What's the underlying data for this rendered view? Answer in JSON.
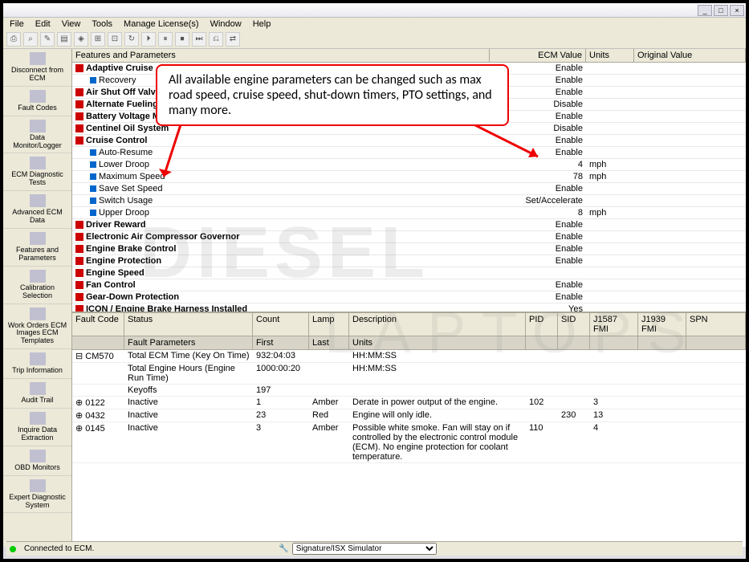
{
  "window": {
    "min": "_",
    "max": "□",
    "close": "×"
  },
  "menu": [
    "File",
    "Edit",
    "View",
    "Tools",
    "Manage License(s)",
    "Window",
    "Help"
  ],
  "sidebar": [
    {
      "label": "Disconnect from ECM"
    },
    {
      "label": "Fault Codes"
    },
    {
      "label": "Data Monitor/Logger"
    },
    {
      "label": "ECM Diagnostic Tests"
    },
    {
      "label": "Advanced ECM Data"
    },
    {
      "label": "Features and Parameters"
    },
    {
      "label": "Calibration Selection"
    },
    {
      "label": "Work Orders ECM Images ECM Templates"
    },
    {
      "label": "Trip Information"
    },
    {
      "label": "Audit Trail"
    },
    {
      "label": "Inquire Data Extraction"
    },
    {
      "label": "OBD Monitors"
    },
    {
      "label": "Expert Diagnostic System"
    }
  ],
  "params_header": {
    "c1": "Features and Parameters",
    "c2": "ECM Value",
    "c3": "Units",
    "c4": "Original Value"
  },
  "params": [
    {
      "name": "Adaptive Cruise",
      "val": "Enable",
      "unit": "",
      "bold": true,
      "sub": false
    },
    {
      "name": "Recovery",
      "val": "Enable",
      "unit": "",
      "bold": false,
      "sub": true
    },
    {
      "name": "Air Shut Off Valve",
      "val": "Enable",
      "unit": "",
      "bold": true,
      "sub": false
    },
    {
      "name": "Alternate Fueling Table",
      "val": "Disable",
      "unit": "",
      "bold": true,
      "sub": false
    },
    {
      "name": "Battery Voltage Monitor",
      "val": "Enable",
      "unit": "",
      "bold": true,
      "sub": false
    },
    {
      "name": "Centinel Oil System",
      "val": "Disable",
      "unit": "",
      "bold": true,
      "sub": false
    },
    {
      "name": "Cruise Control",
      "val": "Enable",
      "unit": "",
      "bold": true,
      "sub": false
    },
    {
      "name": "Auto-Resume",
      "val": "Enable",
      "unit": "",
      "bold": false,
      "sub": true
    },
    {
      "name": "Lower Droop",
      "val": "4",
      "unit": "mph",
      "bold": false,
      "sub": true
    },
    {
      "name": "Maximum Speed",
      "val": "78",
      "unit": "mph",
      "bold": false,
      "sub": true
    },
    {
      "name": "Save Set Speed",
      "val": "Enable",
      "unit": "",
      "bold": false,
      "sub": true
    },
    {
      "name": "Switch Usage",
      "val": "Set/Accelerate",
      "unit": "",
      "bold": false,
      "sub": true
    },
    {
      "name": "Upper Droop",
      "val": "8",
      "unit": "mph",
      "bold": false,
      "sub": true
    },
    {
      "name": "Driver Reward",
      "val": "Enable",
      "unit": "",
      "bold": true,
      "sub": false
    },
    {
      "name": "Electronic Air Compressor Governor",
      "val": "Enable",
      "unit": "",
      "bold": true,
      "sub": false
    },
    {
      "name": "Engine Brake Control",
      "val": "Enable",
      "unit": "",
      "bold": true,
      "sub": false
    },
    {
      "name": "Engine Protection",
      "val": "Enable",
      "unit": "",
      "bold": true,
      "sub": false
    },
    {
      "name": "Engine Speed",
      "val": "",
      "unit": "",
      "bold": true,
      "sub": false
    },
    {
      "name": "Fan Control",
      "val": "Enable",
      "unit": "",
      "bold": true,
      "sub": false
    },
    {
      "name": "Gear-Down Protection",
      "val": "Enable",
      "unit": "",
      "bold": true,
      "sub": false
    },
    {
      "name": "ICON / Engine Brake Harness Installed",
      "val": "Yes",
      "unit": "",
      "bold": true,
      "sub": false
    }
  ],
  "fc_header": {
    "c1": "Fault Code",
    "c2": "Status",
    "c3": "Count",
    "c4": "Lamp",
    "c5": "Description",
    "c6": "PID",
    "c7": "SID",
    "c8": "J1587 FMI",
    "c9": "J1939 FMI",
    "c10": "SPN"
  },
  "fc_subheader": {
    "c1": "",
    "c2": "Fault Parameters",
    "c3": "First",
    "c4": "Last",
    "c5": "Units",
    "c6": "",
    "c7": "",
    "c8": "",
    "c9": "",
    "c10": ""
  },
  "fc_rows": [
    {
      "code": "CM570",
      "status": "Total ECM Time (Key On Time)",
      "count": "932:04:03",
      "lamp": "",
      "desc": "HH:MM:SS",
      "pid": "",
      "sid": "",
      "j1587": "",
      "j1939": "",
      "spn": "",
      "exp": "⊟"
    },
    {
      "code": "",
      "status": "Total Engine Hours (Engine Run Time)",
      "count": "1000:00:20",
      "lamp": "",
      "desc": "HH:MM:SS",
      "pid": "",
      "sid": "",
      "j1587": "",
      "j1939": "",
      "spn": "",
      "exp": ""
    },
    {
      "code": "",
      "status": "Keyoffs",
      "count": "197",
      "lamp": "",
      "desc": "",
      "pid": "",
      "sid": "",
      "j1587": "",
      "j1939": "",
      "spn": "",
      "exp": ""
    },
    {
      "code": "0122",
      "status": "Inactive",
      "count": "1",
      "lamp": "Amber",
      "desc": "Derate in power output of the engine.",
      "pid": "102",
      "sid": "",
      "j1587": "3",
      "j1939": "",
      "spn": "",
      "exp": "⊕"
    },
    {
      "code": "0432",
      "status": "Inactive",
      "count": "23",
      "lamp": "Red",
      "desc": "Engine will only idle.",
      "pid": "",
      "sid": "230",
      "j1587": "13",
      "j1939": "",
      "spn": "",
      "exp": "⊕"
    },
    {
      "code": "0145",
      "status": "Inactive",
      "count": "3",
      "lamp": "Amber",
      "desc": "Possible white smoke.  Fan will stay on if controlled by the electronic control module (ECM).  No engine protection for coolant temperature.",
      "pid": "110",
      "sid": "",
      "j1587": "4",
      "j1939": "",
      "spn": "",
      "exp": "⊕"
    }
  ],
  "fc_tab": "Fault Codes",
  "status": {
    "text": "Connected to ECM.",
    "sim": "Signature/ISX Simulator"
  },
  "callout": "All available engine parameters can be changed such as max road speed, cruise speed, shut-down timers, PTO settings, and many more.",
  "watermark1": "DIESEL",
  "watermark2": "LAPTOPS"
}
